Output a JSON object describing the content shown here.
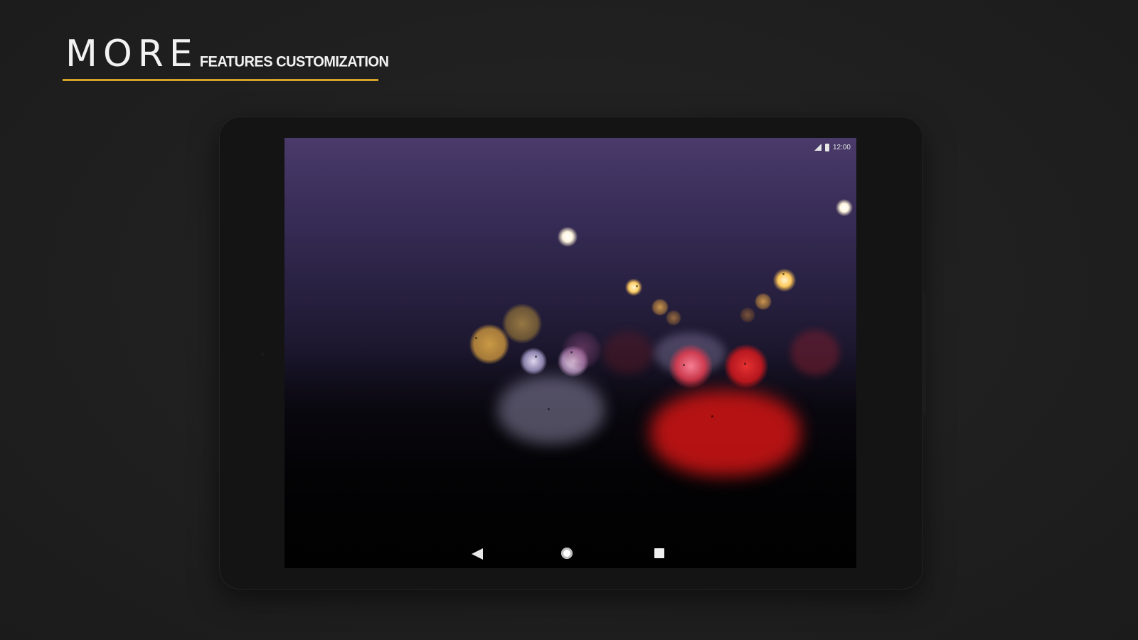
{
  "headline": {
    "big": "MORE",
    "small": "FEATURES CUSTOMIZATION",
    "accent_color": "#d7a326"
  },
  "device": {
    "status_bar": {
      "time": "12:00",
      "icons": [
        "signal-icon",
        "battery-icon"
      ]
    },
    "wallpaper": "night-road-bokeh",
    "navigation": {
      "icons": [
        "back-icon",
        "home-icon",
        "recents-icon"
      ]
    }
  },
  "colors": {
    "background": "#1f1f1f",
    "tablet_bezel": "#141414",
    "sky_top": "#4a3a6b",
    "tail_light_red": "#c41616",
    "street_light": "#ffd98a"
  }
}
